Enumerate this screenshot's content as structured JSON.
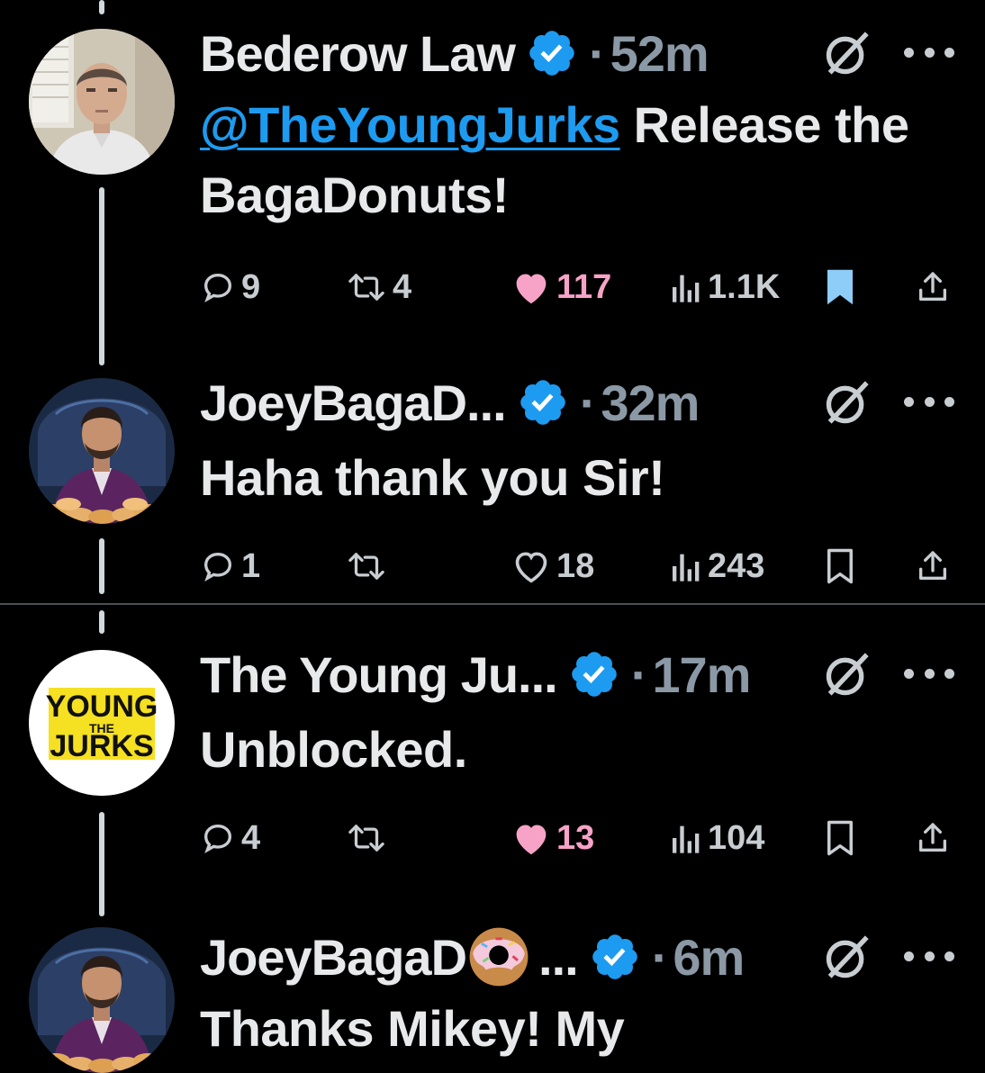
{
  "tweets": [
    {
      "name": "Bederow Law",
      "time": "52m",
      "mention": "@TheYoungJurks",
      "text_after_mention": " Release the BagaDonuts!",
      "text": "",
      "replies": "9",
      "reposts": "4",
      "likes": "117",
      "liked": true,
      "views": "1.1K",
      "bookmarked": true,
      "avatar": "man-in-office-photo"
    },
    {
      "name": "JoeyBagaD...",
      "time": "32m",
      "text": "Haha thank you Sir!",
      "replies": "1",
      "reposts": "",
      "likes": "18",
      "liked": false,
      "views": "243",
      "bookmarked": false,
      "avatar": "man-with-donuts-photo"
    },
    {
      "name": "The Young Ju...",
      "time": "17m",
      "text": "Unblocked.",
      "replies": "4",
      "reposts": "",
      "likes": "13",
      "liked": true,
      "views": "104",
      "bookmarked": false,
      "avatar": "young-jurks-logo",
      "logo_text": [
        "YOUNG",
        "THE",
        "JURKS"
      ]
    },
    {
      "name": "JoeyBagaD",
      "name_suffix": "...",
      "time": "6m",
      "text": "Thanks Mikey! My",
      "avatar": "man-with-donuts-photo",
      "emoji": "donut-emoji"
    }
  ],
  "separator": "·",
  "colors": {
    "background": "#000000",
    "text": "#e7e9ea",
    "muted": "#8b98a5",
    "link": "#1d9bf0",
    "like": "#f91880",
    "verified": "#1d9bf0",
    "bookmark_active": "#8ecdf8"
  },
  "icons": [
    "verified-badge-icon",
    "grok-icon",
    "more-icon",
    "reply-icon",
    "repost-icon",
    "like-icon",
    "views-icon",
    "bookmark-icon",
    "share-icon"
  ]
}
